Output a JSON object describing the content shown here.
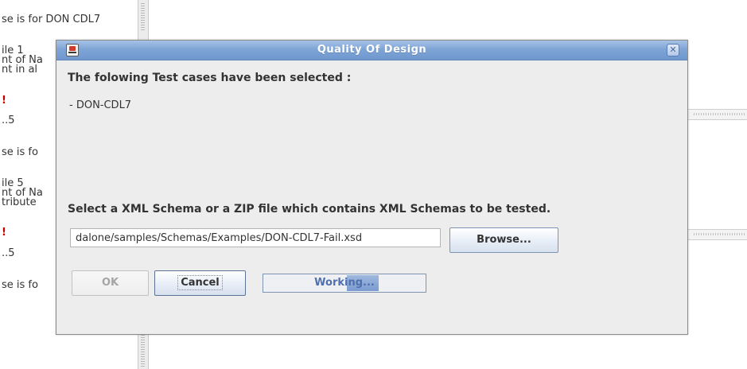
{
  "background": {
    "text_lines": [
      "se is for DON CDL7",
      "ile 1",
      "nt of Na",
      "nt in al",
      "!",
      "..5",
      "se is fo",
      "ile 5",
      "nt of Na",
      "tribute",
      "!",
      "..5",
      "se is fo"
    ]
  },
  "dialog": {
    "title": "Quality Of Design",
    "heading": "The folowing Test cases have been selected :",
    "selected_cases": [
      "- DON-CDL7"
    ],
    "schema_prompt": "Select a XML Schema or a ZIP file which contains XML Schemas to be tested.",
    "schema_path": "dalone/samples/Schemas/Examples/DON-CDL7-Fail.xsd",
    "browse_label": "Browse...",
    "ok_label": "OK",
    "cancel_label": "Cancel",
    "progress_text": "Working...",
    "ok_enabled": false
  },
  "icons": {
    "app": "java-app-icon",
    "close": "close-icon"
  },
  "colors": {
    "title_bar": "#7fa5d6",
    "dialog_bg": "#ededed",
    "warning_text": "#c00000",
    "progress_fill": "#7b9bd0"
  }
}
